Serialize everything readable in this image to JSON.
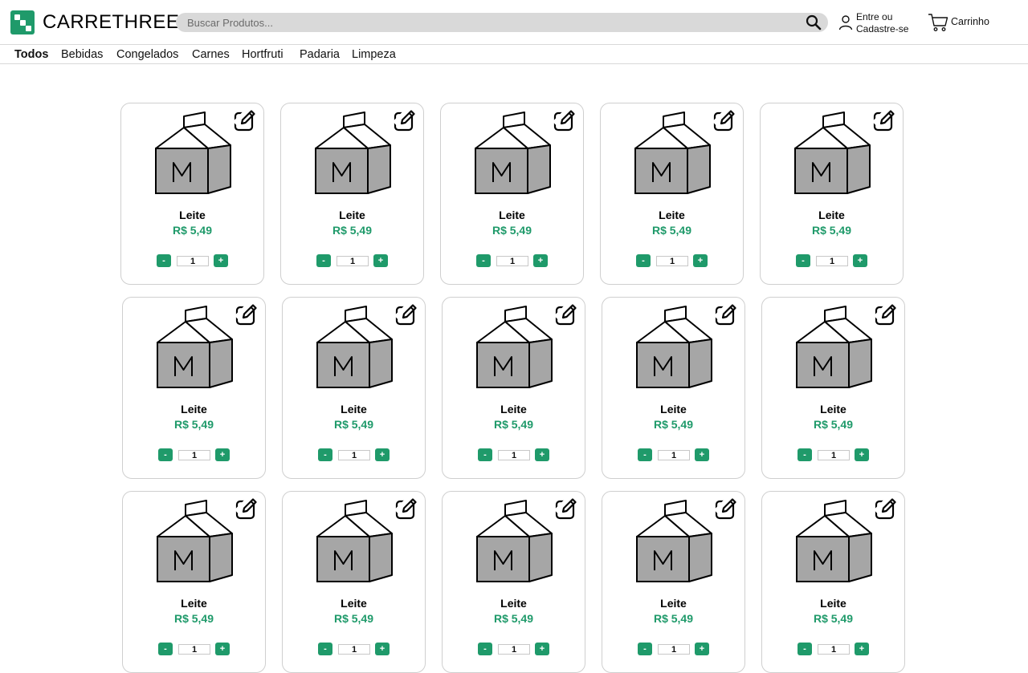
{
  "header": {
    "logo_text": "CARRETHREE",
    "search_placeholder": "Buscar Produtos...",
    "account_line1": "Entre ou",
    "account_line2": "Cadastre-se",
    "cart_label": "Carrinho"
  },
  "nav": {
    "items": [
      "Todos",
      "Bebidas",
      "Congelados",
      "Carnes",
      "Hortfruti",
      "Padaria",
      "Limpeza"
    ],
    "active": "Todos"
  },
  "colors": {
    "accent": "#1f9a6a",
    "product_body": "#a6a6a6"
  },
  "product_icon": "milk-carton-icon",
  "products": [
    {
      "name": "Leite",
      "price": "R$ 5,49",
      "qty": "1"
    },
    {
      "name": "Leite",
      "price": "R$ 5,49",
      "qty": "1"
    },
    {
      "name": "Leite",
      "price": "R$ 5,49",
      "qty": "1"
    },
    {
      "name": "Leite",
      "price": "R$ 5,49",
      "qty": "1"
    },
    {
      "name": "Leite",
      "price": "R$ 5,49",
      "qty": "1"
    },
    {
      "name": "Leite",
      "price": "R$ 5,49",
      "qty": "1"
    },
    {
      "name": "Leite",
      "price": "R$ 5,49",
      "qty": "1"
    },
    {
      "name": "Leite",
      "price": "R$ 5,49",
      "qty": "1"
    },
    {
      "name": "Leite",
      "price": "R$ 5,49",
      "qty": "1"
    },
    {
      "name": "Leite",
      "price": "R$ 5,49",
      "qty": "1"
    },
    {
      "name": "Leite",
      "price": "R$ 5,49",
      "qty": "1"
    },
    {
      "name": "Leite",
      "price": "R$ 5,49",
      "qty": "1"
    },
    {
      "name": "Leite",
      "price": "R$ 5,49",
      "qty": "1"
    },
    {
      "name": "Leite",
      "price": "R$ 5,49",
      "qty": "1"
    },
    {
      "name": "Leite",
      "price": "R$ 5,49",
      "qty": "1"
    }
  ],
  "qty_controls": {
    "minus": "-",
    "plus": "+"
  }
}
